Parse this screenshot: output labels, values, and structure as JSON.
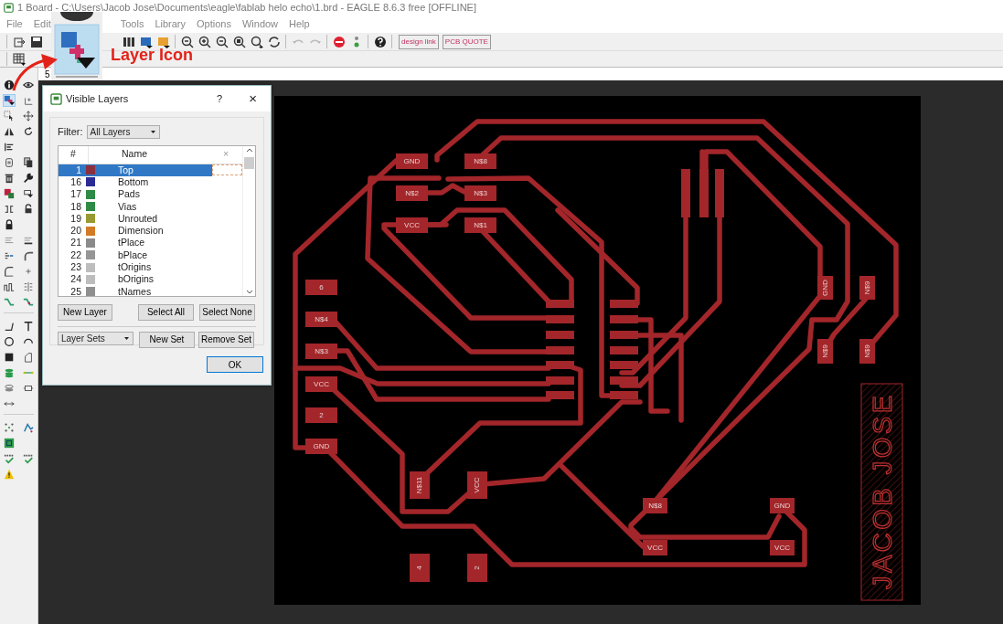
{
  "window": {
    "title": "1 Board - C:\\Users\\Jacob Jose\\Documents\\eagle\\fablab helo echo\\1.brd - EAGLE 8.6.3 free [OFFLINE]"
  },
  "menu": [
    {
      "label": "File"
    },
    {
      "label": "Edit"
    },
    {
      "label": "Tools"
    },
    {
      "label": "Library"
    },
    {
      "label": "Options"
    },
    {
      "label": "Window"
    },
    {
      "label": "Help"
    }
  ],
  "toolbar": {
    "link_buttons": [
      {
        "label": "design link"
      },
      {
        "label": "PCB QUOTE"
      }
    ]
  },
  "command": {
    "value": "5"
  },
  "callout": {
    "label": "Layer Icon"
  },
  "dialog": {
    "title": "Visible Layers",
    "help": "?",
    "close": "×",
    "filter_label": "Filter:",
    "filter_value": "All Layers",
    "columns": [
      "#",
      "Name",
      "×"
    ],
    "layers": [
      {
        "number": "1",
        "name": "Top",
        "color": "#8c3040",
        "selected": true
      },
      {
        "number": "16",
        "name": "Bottom",
        "color": "#2b2b96",
        "selected": false
      },
      {
        "number": "17",
        "name": "Pads",
        "color": "#2e8b45",
        "selected": false
      },
      {
        "number": "18",
        "name": "Vias",
        "color": "#2e8b45",
        "selected": false
      },
      {
        "number": "19",
        "name": "Unrouted",
        "color": "#999933",
        "selected": false
      },
      {
        "number": "20",
        "name": "Dimension",
        "color": "#d27a26",
        "selected": false
      },
      {
        "number": "21",
        "name": "tPlace",
        "color": "#8a8a8a",
        "selected": false
      },
      {
        "number": "22",
        "name": "bPlace",
        "color": "#969696",
        "selected": false
      },
      {
        "number": "23",
        "name": "tOrigins",
        "color": "#bdbdbd",
        "selected": false
      },
      {
        "number": "24",
        "name": "bOrigins",
        "color": "#bdbdbd",
        "selected": false
      },
      {
        "number": "25",
        "name": "tNames",
        "color": "#8f8f8f",
        "selected": false
      }
    ],
    "layer_buttons": [
      "New Layer",
      "Select All",
      "Select None"
    ],
    "sets_value": "Layer Sets",
    "set_buttons": [
      "New Set",
      "Remove Set"
    ],
    "ok": "OK"
  },
  "board": {
    "pads": [
      {
        "label": "GND"
      },
      {
        "label": "N$8"
      },
      {
        "label": "N$2"
      },
      {
        "label": "N$3"
      },
      {
        "label": "VCC"
      },
      {
        "label": "N$1"
      },
      {
        "label": "6"
      },
      {
        "label": "N$4"
      },
      {
        "label": "N$3"
      },
      {
        "label": "VCC"
      },
      {
        "label": "2"
      },
      {
        "label": "GND"
      },
      {
        "label": "N$11"
      },
      {
        "label": "VCC"
      },
      {
        "label": "4"
      },
      {
        "label": "2"
      },
      {
        "label": "GND"
      },
      {
        "label": "N$9"
      },
      {
        "label": "N$9"
      },
      {
        "label": "N$9"
      },
      {
        "label": "N$8"
      },
      {
        "label": "GND"
      },
      {
        "label": "VCC"
      },
      {
        "label": "VCC"
      }
    ],
    "nameplate": "JACOB JOSE"
  }
}
